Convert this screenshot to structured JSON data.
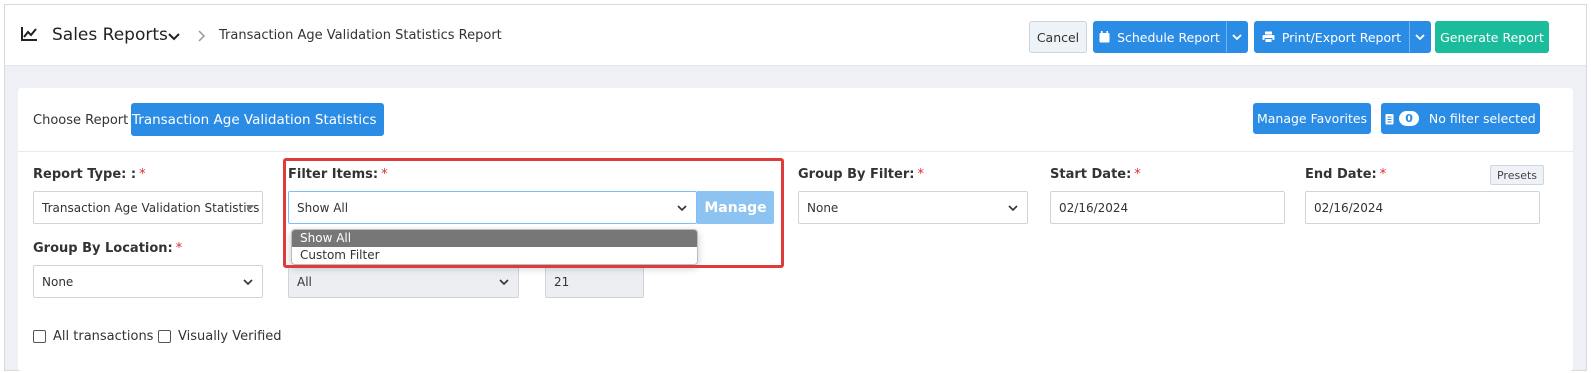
{
  "header": {
    "title": "Sales Reports",
    "breadcrumb": "Transaction Age Validation Statistics Report",
    "buttons": {
      "cancel": "Cancel",
      "schedule": "Schedule Report",
      "print_export": "Print/Export Report",
      "generate": "Generate Report"
    }
  },
  "choose_report": {
    "label": "Choose Report",
    "selected": "Transaction Age Validation Statistics"
  },
  "actions": {
    "manage_favorites": "Manage Favorites",
    "filter_count": "0",
    "filter_status": "No filter selected"
  },
  "fields": {
    "report_type": {
      "label": "Report Type: :",
      "required": "*",
      "value": "Transaction Age Validation Statistics"
    },
    "filter_items": {
      "label": "Filter Items:",
      "required": "*",
      "value": "Show All",
      "manage": "Manage",
      "options": [
        "Show All",
        "Custom Filter"
      ]
    },
    "group_by_filter": {
      "label": "Group By Filter:",
      "required": "*",
      "value": "None"
    },
    "start_date": {
      "label": "Start Date:",
      "required": "*",
      "value": "02/16/2024"
    },
    "end_date": {
      "label": "End Date:",
      "required": "*",
      "value": "02/16/2024",
      "presets": "Presets"
    },
    "group_by_location": {
      "label": "Group By Location:",
      "required": "*",
      "value": "None"
    },
    "second_select": {
      "value": "All"
    },
    "number_field": {
      "value": "21"
    }
  },
  "checkboxes": {
    "all_transactions": "All transactions",
    "visually_verified": "Visually Verified"
  },
  "colors": {
    "primary": "#2b8ce6",
    "teal": "#1abc9c",
    "required": "#e02b27",
    "highlight": "#e03b3b"
  }
}
